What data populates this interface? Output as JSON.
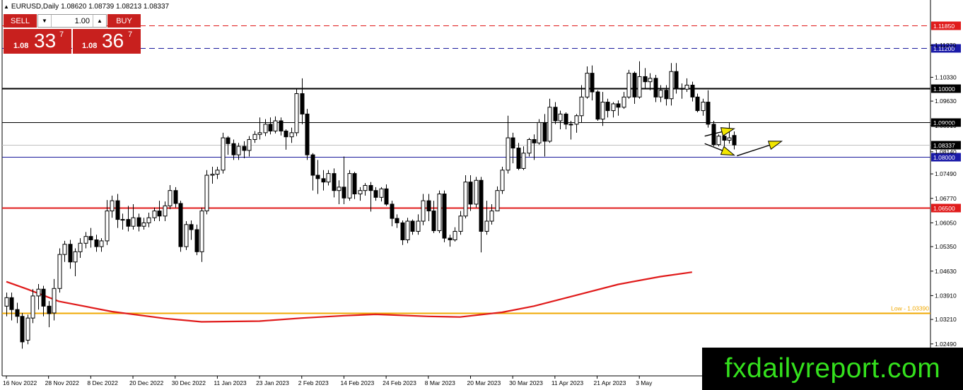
{
  "header": {
    "symbol": "EURUSD,Daily",
    "ohlc": "1.08620 1.08739 1.08213 1.08337"
  },
  "trade_panel": {
    "sell_label": "SELL",
    "buy_label": "BUY",
    "lot_size": "1.00",
    "sell_quote": {
      "prefix": "1.08",
      "big": "33",
      "sup": "7"
    },
    "buy_quote": {
      "prefix": "1.08",
      "big": "36",
      "sup": "7"
    }
  },
  "colors": {
    "background": "#ffffff",
    "candle": "#000000",
    "ma_line": "#e01b1b",
    "resistance_red": "#e01b1b",
    "resistance_blue": "#1a1a9c",
    "support_gold": "#f0a800",
    "arrow_fill": "#f2e600",
    "badge_red": "#e01b1b",
    "badge_blue": "#1a1aa8",
    "brand_bg": "#000000",
    "brand_text": "#34e11d"
  },
  "chart_data": {
    "type": "candlestick",
    "symbol": "EURUSD",
    "timeframe": "Daily",
    "ylim": [
      1.0155,
      1.1225
    ],
    "y_ticks": [
      1.1127,
      1.1033,
      1.0963,
      1.0891,
      1.0814,
      1.0749,
      1.0677,
      1.0605,
      1.0535,
      1.0463,
      1.0391,
      1.0321,
      1.0249
    ],
    "y_tick_labels": [
      "1.11270",
      "1.10330",
      "1.09630",
      "1.08910",
      "1.08140",
      "1.07490",
      "1.06770",
      "1.06050",
      "1.05350",
      "1.04630",
      "1.03910",
      "1.03210",
      "1.02490"
    ],
    "x_labels": [
      "16 Nov 2022",
      "28 Nov 2022",
      "8 Dec 2022",
      "20 Dec 2022",
      "30 Dec 2022",
      "11 Jan 2023",
      "23 Jan 2023",
      "2 Feb 2023",
      "14 Feb 2023",
      "24 Feb 2023",
      "8 Mar 2023",
      "20 Mar 2023",
      "30 Mar 2023",
      "11 Apr 2023",
      "21 Apr 2023",
      "3 May"
    ],
    "x_label_bar_index": [
      0,
      8,
      16,
      24,
      32,
      40,
      48,
      56,
      64,
      72,
      80,
      88,
      96,
      104,
      112,
      120
    ],
    "horizontal_lines": [
      {
        "price": 1.1185,
        "label": "1.11850",
        "style": "dashed",
        "color": "#e01b1b",
        "badge": "#e01b1b"
      },
      {
        "price": 1.112,
        "label": "1.11200",
        "style": "dashed",
        "color": "#1a1a9c",
        "badge": "#1a1aa8"
      },
      {
        "price": 1.1,
        "label": "1.10000",
        "style": "solid",
        "color": "#000000",
        "badge": "#000000",
        "width": 2
      },
      {
        "price": 1.09,
        "label": "1.09000",
        "style": "solid",
        "color": "#000000",
        "badge": "#000000",
        "width": 1
      },
      {
        "price": 1.08337,
        "label": "1.08337",
        "style": "solid",
        "color": "#c0c0c0",
        "badge": "#000000",
        "width": 1
      },
      {
        "price": 1.08,
        "label": "1.08000",
        "style": "solid",
        "color": "#1a1a9c",
        "badge": "#1a1aa8",
        "width": 1
      },
      {
        "price": 1.065,
        "label": "1.06500",
        "style": "solid",
        "color": "#e01b1b",
        "badge": "#e01b1b",
        "width": 2
      },
      {
        "price": 1.0339,
        "label": "Low - 1.03390",
        "style": "solid",
        "color": "#f0a800",
        "badge": "none",
        "width": 2
      }
    ],
    "moving_average": [
      [
        0,
        1.0432
      ],
      [
        4,
        1.041
      ],
      [
        10,
        1.0374
      ],
      [
        20,
        1.0344
      ],
      [
        30,
        1.0324
      ],
      [
        37,
        1.0314
      ],
      [
        48,
        1.0316
      ],
      [
        56,
        1.0325
      ],
      [
        64,
        1.0332
      ],
      [
        70,
        1.0336
      ],
      [
        80,
        1.033
      ],
      [
        86,
        1.0328
      ],
      [
        94,
        1.0342
      ],
      [
        100,
        1.036
      ],
      [
        108,
        1.0392
      ],
      [
        116,
        1.0424
      ],
      [
        124,
        1.0447
      ],
      [
        130,
        1.046
      ]
    ],
    "candles": [
      [
        1.036,
        1.0385,
        1.033,
        1.04
      ],
      [
        1.0385,
        1.035,
        1.0318,
        1.04
      ],
      [
        1.035,
        1.033,
        1.031,
        1.037
      ],
      [
        1.033,
        1.0255,
        1.0235,
        1.034
      ],
      [
        1.026,
        1.0325,
        1.0248,
        1.0335
      ],
      [
        1.0325,
        1.039,
        1.031,
        1.041
      ],
      [
        1.039,
        1.041,
        1.035,
        1.0425
      ],
      [
        1.041,
        1.036,
        1.033,
        1.042
      ],
      [
        1.036,
        1.0338,
        1.0298,
        1.0375
      ],
      [
        1.034,
        1.0412,
        1.0318,
        1.044
      ],
      [
        1.0412,
        1.0512,
        1.04,
        1.053
      ],
      [
        1.0512,
        1.0542,
        1.049,
        1.0552
      ],
      [
        1.0542,
        1.049,
        1.047,
        1.0555
      ],
      [
        1.049,
        1.052,
        1.0448,
        1.053
      ],
      [
        1.052,
        1.0545,
        1.0502,
        1.056
      ],
      [
        1.0545,
        1.0565,
        1.053,
        1.0578
      ],
      [
        1.0565,
        1.0555,
        1.0532,
        1.059
      ],
      [
        1.0555,
        1.0535,
        1.052,
        1.057
      ],
      [
        1.0535,
        1.0552,
        1.052,
        1.056
      ],
      [
        1.0552,
        1.064,
        1.054,
        1.0672
      ],
      [
        1.064,
        1.067,
        1.062,
        1.0685
      ],
      [
        1.067,
        1.0615,
        1.059,
        1.069
      ],
      [
        1.0615,
        1.0615,
        1.0585,
        1.0632
      ],
      [
        1.0615,
        1.0595,
        1.058,
        1.0655
      ],
      [
        1.0595,
        1.062,
        1.0585,
        1.066
      ],
      [
        1.062,
        1.0595,
        1.058,
        1.0632
      ],
      [
        1.0595,
        1.0605,
        1.0585,
        1.062
      ],
      [
        1.0605,
        1.062,
        1.0592,
        1.0635
      ],
      [
        1.062,
        1.064,
        1.061,
        1.065
      ],
      [
        1.064,
        1.0625,
        1.061,
        1.067
      ],
      [
        1.0625,
        1.0655,
        1.061,
        1.0668
      ],
      [
        1.0655,
        1.07,
        1.0645,
        1.0716
      ],
      [
        1.07,
        1.0662,
        1.065,
        1.071
      ],
      [
        1.0662,
        1.0535,
        1.052,
        1.067
      ],
      [
        1.0535,
        1.06,
        1.0525,
        1.061
      ],
      [
        1.06,
        1.0585,
        1.0555,
        1.0612
      ],
      [
        1.0585,
        1.052,
        1.051,
        1.06
      ],
      [
        1.052,
        1.064,
        1.049,
        1.065
      ],
      [
        1.064,
        1.0745,
        1.063,
        1.076
      ],
      [
        1.0745,
        1.0748,
        1.072,
        1.077
      ],
      [
        1.0748,
        1.076,
        1.0734,
        1.077
      ],
      [
        1.076,
        1.0855,
        1.075,
        1.087
      ],
      [
        1.0855,
        1.0838,
        1.0805,
        1.086
      ],
      [
        1.0838,
        1.0805,
        1.079,
        1.085
      ],
      [
        1.0805,
        1.083,
        1.079,
        1.084
      ],
      [
        1.083,
        1.0818,
        1.0795,
        1.0845
      ],
      [
        1.0818,
        1.085,
        1.08,
        1.086
      ],
      [
        1.085,
        1.0865,
        1.084,
        1.0875
      ],
      [
        1.0865,
        1.087,
        1.085,
        1.0915
      ],
      [
        1.087,
        1.0895,
        1.086,
        1.091
      ],
      [
        1.0895,
        1.0875,
        1.0865,
        1.0915
      ],
      [
        1.0875,
        1.0905,
        1.0868,
        1.0918
      ],
      [
        1.0905,
        1.0875,
        1.0862,
        1.0915
      ],
      [
        1.0875,
        1.0858,
        1.082,
        1.088
      ],
      [
        1.0858,
        1.087,
        1.084,
        1.0885
      ],
      [
        1.087,
        1.0985,
        1.086,
        1.1
      ],
      [
        1.0985,
        1.0925,
        1.0895,
        1.103
      ],
      [
        1.0925,
        1.0805,
        1.079,
        1.094
      ],
      [
        1.0805,
        1.0745,
        1.07,
        1.081
      ],
      [
        1.0745,
        1.0735,
        1.069,
        1.079
      ],
      [
        1.0735,
        1.0725,
        1.07,
        1.076
      ],
      [
        1.0725,
        1.075,
        1.0715,
        1.076
      ],
      [
        1.075,
        1.07,
        1.068,
        1.0765
      ],
      [
        1.07,
        1.071,
        1.066,
        1.073
      ],
      [
        1.071,
        1.0678,
        1.066,
        1.08
      ],
      [
        1.0678,
        1.075,
        1.067,
        1.076
      ],
      [
        1.075,
        1.069,
        1.0675,
        1.0755
      ],
      [
        1.069,
        1.07,
        1.067,
        1.071
      ],
      [
        1.07,
        1.0715,
        1.0685,
        1.0722
      ],
      [
        1.0715,
        1.07,
        1.0638,
        1.0725
      ],
      [
        1.07,
        1.068,
        1.067,
        1.071
      ],
      [
        1.068,
        1.0705,
        1.0668,
        1.071
      ],
      [
        1.0705,
        1.066,
        1.0655,
        1.0718
      ],
      [
        1.066,
        1.0618,
        1.0595,
        1.067
      ],
      [
        1.0618,
        1.0605,
        1.059,
        1.063
      ],
      [
        1.0605,
        1.0555,
        1.054,
        1.0612
      ],
      [
        1.0555,
        1.061,
        1.0545,
        1.062
      ],
      [
        1.061,
        1.058,
        1.057,
        1.0615
      ],
      [
        1.058,
        1.061,
        1.057,
        1.063
      ],
      [
        1.061,
        1.067,
        1.0598,
        1.069
      ],
      [
        1.067,
        1.064,
        1.061,
        1.069
      ],
      [
        1.064,
        1.0582,
        1.0575,
        1.067
      ],
      [
        1.0582,
        1.069,
        1.0575,
        1.07
      ],
      [
        1.069,
        1.056,
        1.0548,
        1.07
      ],
      [
        1.056,
        1.0555,
        1.0535,
        1.057
      ],
      [
        1.0555,
        1.058,
        1.055,
        1.0592
      ],
      [
        1.058,
        1.0625,
        1.057,
        1.064
      ],
      [
        1.0625,
        1.0725,
        1.0618,
        1.0745
      ],
      [
        1.0725,
        1.066,
        1.064,
        1.0745
      ],
      [
        1.066,
        1.073,
        1.065,
        1.074
      ],
      [
        1.073,
        1.058,
        1.0518,
        1.074
      ],
      [
        1.058,
        1.061,
        1.057,
        1.067
      ],
      [
        1.061,
        1.064,
        1.06,
        1.066
      ],
      [
        1.064,
        1.07,
        1.064,
        1.0712
      ],
      [
        1.07,
        1.076,
        1.069,
        1.077
      ],
      [
        1.076,
        1.0855,
        1.075,
        1.092
      ],
      [
        1.0855,
        1.0825,
        1.078,
        1.087
      ],
      [
        1.0825,
        1.0765,
        1.076,
        1.084
      ],
      [
        1.0765,
        1.081,
        1.076,
        1.083
      ],
      [
        1.081,
        1.085,
        1.08,
        1.0855
      ],
      [
        1.085,
        1.084,
        1.079,
        1.0865
      ],
      [
        1.084,
        1.09,
        1.0835,
        1.091
      ],
      [
        1.09,
        1.0845,
        1.08,
        1.0925
      ],
      [
        1.0845,
        1.0945,
        1.084,
        1.097
      ],
      [
        1.0945,
        1.0905,
        1.0895,
        1.096
      ],
      [
        1.0905,
        1.0925,
        1.088,
        1.0935
      ],
      [
        1.0925,
        1.0895,
        1.088,
        1.093
      ],
      [
        1.0895,
        1.0895,
        1.085,
        1.0905
      ],
      [
        1.0895,
        1.092,
        1.087,
        1.0925
      ],
      [
        1.092,
        1.0975,
        1.09,
        1.101
      ],
      [
        1.0975,
        1.1045,
        1.097,
        1.1065
      ],
      [
        1.1045,
        1.099,
        1.0965,
        1.1068
      ],
      [
        1.099,
        1.091,
        1.0905,
        1.0995
      ],
      [
        1.091,
        1.096,
        1.089,
        1.099
      ],
      [
        1.096,
        1.0935,
        1.0915,
        1.097
      ],
      [
        1.0935,
        1.0955,
        1.0915,
        1.096
      ],
      [
        1.0955,
        1.0945,
        1.092,
        1.0965
      ],
      [
        1.0945,
        1.0975,
        1.094,
        1.099
      ],
      [
        1.0975,
        1.1045,
        1.097,
        1.1055
      ],
      [
        1.1045,
        1.0975,
        1.0955,
        1.105
      ],
      [
        1.0975,
        1.1035,
        1.097,
        1.108
      ],
      [
        1.1035,
        1.102,
        1.1,
        1.106
      ],
      [
        1.102,
        1.103,
        1.0995,
        1.1045
      ],
      [
        1.103,
        1.0975,
        1.096,
        1.104
      ],
      [
        1.0975,
        1.0995,
        1.096,
        1.101
      ],
      [
        1.0995,
        1.097,
        1.095,
        1.101
      ],
      [
        1.097,
        1.105,
        1.095,
        1.1075
      ],
      [
        1.105,
        1.1,
        1.0985,
        1.1075
      ],
      [
        1.1,
        1.0998,
        1.097,
        1.1015
      ],
      [
        1.0998,
        1.101,
        1.099,
        1.103
      ],
      [
        1.101,
        1.0975,
        1.0962,
        1.102
      ],
      [
        1.0975,
        1.0935,
        1.093,
        1.0985
      ],
      [
        1.0935,
        1.096,
        1.092,
        1.097
      ],
      [
        1.096,
        1.0895,
        1.0885,
        1.0995
      ],
      [
        1.0895,
        1.0835,
        1.083,
        1.0905
      ],
      [
        1.0835,
        1.086,
        1.083,
        1.0865
      ],
      [
        1.086,
        1.0848,
        1.083,
        1.088
      ],
      [
        1.0848,
        1.0855,
        1.0838,
        1.09
      ],
      [
        1.0862,
        1.0834,
        1.0821,
        1.0874
      ]
    ],
    "annotations": [
      {
        "type": "arrow",
        "from": [
          132.4,
          1.086
        ],
        "to": [
          138.0,
          1.0882
        ]
      },
      {
        "type": "arrow",
        "from": [
          132.4,
          1.0838
        ],
        "to": [
          138.0,
          1.0804
        ]
      },
      {
        "type": "arrow",
        "from": [
          138.5,
          1.0802
        ],
        "to": [
          147.0,
          1.0845
        ]
      }
    ]
  },
  "branding": {
    "text": "fxdailyreport.com"
  }
}
